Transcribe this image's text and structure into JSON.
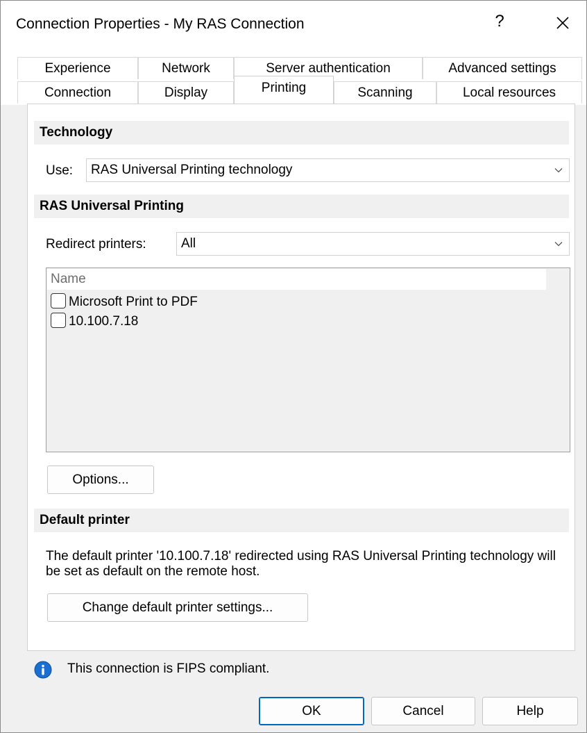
{
  "window": {
    "title": "Connection Properties - My RAS Connection",
    "help_label": "?"
  },
  "tabs": {
    "row1": [
      "Experience",
      "Network",
      "Server authentication",
      "Advanced settings"
    ],
    "row2": [
      "Connection",
      "Display",
      "Printing",
      "Scanning",
      "Local resources"
    ],
    "active": "Printing"
  },
  "technology": {
    "header": "Technology",
    "use_label": "Use:",
    "use_value": "RAS Universal Printing technology"
  },
  "universal": {
    "header": "RAS Universal Printing",
    "redirect_label": "Redirect printers:",
    "redirect_value": "All",
    "list_header": "Name",
    "printers": [
      {
        "name": "Microsoft Print to PDF",
        "checked": false
      },
      {
        "name": "10.100.7.18",
        "checked": false
      }
    ],
    "options_button": "Options..."
  },
  "default_printer": {
    "header": "Default printer",
    "description": "The default printer '10.100.7.18' redirected using RAS Universal Printing technology will be set as default on the remote host.",
    "change_button": "Change default printer settings..."
  },
  "footer": {
    "fips_text": "This connection is FIPS compliant.",
    "ok": "OK",
    "cancel": "Cancel",
    "help": "Help"
  },
  "colors": {
    "accent": "#0067c0",
    "info_icon": "#1a6fd0"
  }
}
